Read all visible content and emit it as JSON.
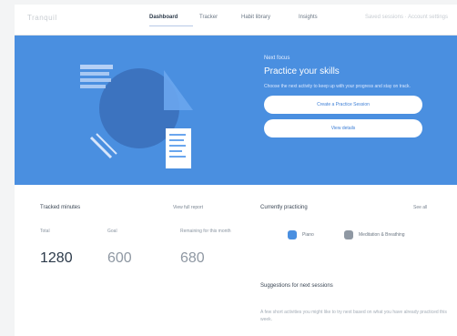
{
  "app": {
    "logo": "Tranquil"
  },
  "nav": {
    "items": [
      {
        "label": "Dashboard",
        "active": true
      },
      {
        "label": "Tracker",
        "active": false
      },
      {
        "label": "Habit library",
        "active": false
      },
      {
        "label": "Insights",
        "active": false
      }
    ],
    "right_label": "Saved sessions  ·  Account settings"
  },
  "hero": {
    "eyebrow": "Next focus",
    "title": "Practice your skills",
    "description": "Choose the next activity to keep up with your progress and stay on track.",
    "primary_button": "Create a Practice Session",
    "secondary_button": "View details"
  },
  "progress": {
    "title": "Tracked minutes",
    "link": "View full report",
    "stats": [
      {
        "label": "Total",
        "value": "1280"
      },
      {
        "label": "Goal",
        "value": "600"
      },
      {
        "label": "Remaining for this month",
        "value": "680"
      }
    ]
  },
  "practice": {
    "title": "Currently practicing",
    "link": "See all",
    "chips": [
      {
        "label": "Piano",
        "color": "#4a8fe0",
        "icon": "music-note-icon"
      },
      {
        "label": "Meditation & Breathing",
        "color": "#8f98a3",
        "icon": "lotus-icon"
      }
    ],
    "subtitle": "Suggestions for next sessions",
    "body": "A few short activities you might like to try next based on what you have already practiced this week."
  },
  "colors": {
    "accent": "#4a8fe0",
    "background": "#f3f4f5",
    "text": "#2c3a4a"
  }
}
